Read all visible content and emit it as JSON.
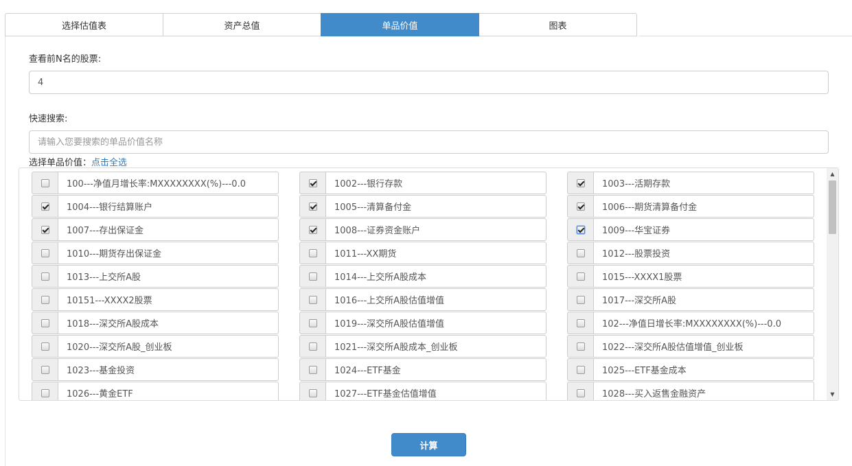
{
  "tabs": [
    {
      "label": "选择估值表",
      "active": false
    },
    {
      "label": "资产总值",
      "active": false
    },
    {
      "label": "单品价值",
      "active": true
    },
    {
      "label": "图表",
      "active": false
    }
  ],
  "top_n": {
    "label": "查看前N名的股票:",
    "value": "4"
  },
  "search": {
    "label": "快速搜索:",
    "placeholder": "请输入您要搜索的单品价值名称"
  },
  "select": {
    "label": "选择单品价值：",
    "select_all": "点击全选"
  },
  "items": [
    {
      "label": "100---净值月增长率:MXXXXXXXX(%)---0.0",
      "checked": false
    },
    {
      "label": "1002---银行存款",
      "checked": true
    },
    {
      "label": "1003---活期存款",
      "checked": true
    },
    {
      "label": "1004---银行结算账户",
      "checked": true
    },
    {
      "label": "1005---清算备付金",
      "checked": true
    },
    {
      "label": "1006---期货清算备付金",
      "checked": true
    },
    {
      "label": "1007---存出保证金",
      "checked": true
    },
    {
      "label": "1008---证券资金账户",
      "checked": true
    },
    {
      "label": "1009---华宝证券",
      "checked": true,
      "focused": true
    },
    {
      "label": "1010---期货存出保证金",
      "checked": false
    },
    {
      "label": "1011---XX期货",
      "checked": false
    },
    {
      "label": "1012---股票投资",
      "checked": false
    },
    {
      "label": "1013---上交所A股",
      "checked": false
    },
    {
      "label": "1014---上交所A股成本",
      "checked": false
    },
    {
      "label": "1015---XXXX1股票",
      "checked": false
    },
    {
      "label": "10151---XXXX2股票",
      "checked": false
    },
    {
      "label": "1016---上交所A股估值增值",
      "checked": false
    },
    {
      "label": "1017---深交所A股",
      "checked": false
    },
    {
      "label": "1018---深交所A股成本",
      "checked": false
    },
    {
      "label": "1019---深交所A股估值增值",
      "checked": false
    },
    {
      "label": "102---净值日增长率:MXXXXXXXX(%)---0.0",
      "checked": false
    },
    {
      "label": "1020---深交所A股_创业板",
      "checked": false
    },
    {
      "label": "1021---深交所A股成本_创业板",
      "checked": false
    },
    {
      "label": "1022---深交所A股估值增值_创业板",
      "checked": false
    },
    {
      "label": "1023---基金投资",
      "checked": false
    },
    {
      "label": "1024---ETF基金",
      "checked": false
    },
    {
      "label": "1025---ETF基金成本",
      "checked": false
    },
    {
      "label": "1026---黄金ETF",
      "checked": false
    },
    {
      "label": "1027---ETF基金估值增值",
      "checked": false
    },
    {
      "label": "1028---买入返售金融资产",
      "checked": false
    }
  ],
  "scrollbar": {
    "up_icon": "▲",
    "down_icon": "▼"
  },
  "calculate_button": "计算"
}
